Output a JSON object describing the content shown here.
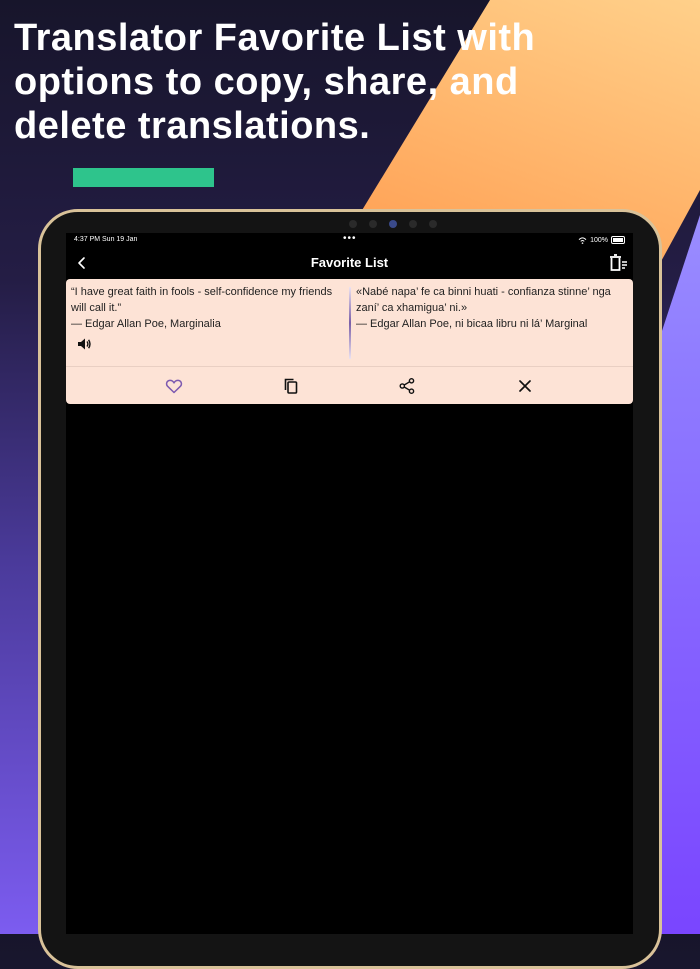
{
  "headline": "Translator Favorite List with options to copy, share, and delete translations.",
  "colors": {
    "accent": "#2ec48c",
    "card_background": "#fde3d6",
    "favorite_icon": "#7d5ab0"
  },
  "status_bar": {
    "time": "4:37 PM  Sun 19 Jan",
    "dots": "•••",
    "battery": "100%"
  },
  "nav": {
    "title": "Favorite List",
    "back_icon": "chevron-left-icon",
    "clear_icon": "delete-list-icon"
  },
  "favorite_item": {
    "source_line1": "“I have great faith in fools - self-confidence my friends will call it.”",
    "source_line2": "— Edgar Allan Poe, Marginalia",
    "translation_line1": "«Nabé napa’ fe ca binni huati - confianza stinne’ nga zaní’ ca xhamigua’ ni.»",
    "translation_line2": "— Edgar Allan Poe, ni bicaa libru ni lá’ Marginal",
    "speaker_icon": "speaker-icon",
    "actions": [
      "heart-icon",
      "copy-icon",
      "share-icon",
      "close-icon"
    ]
  }
}
